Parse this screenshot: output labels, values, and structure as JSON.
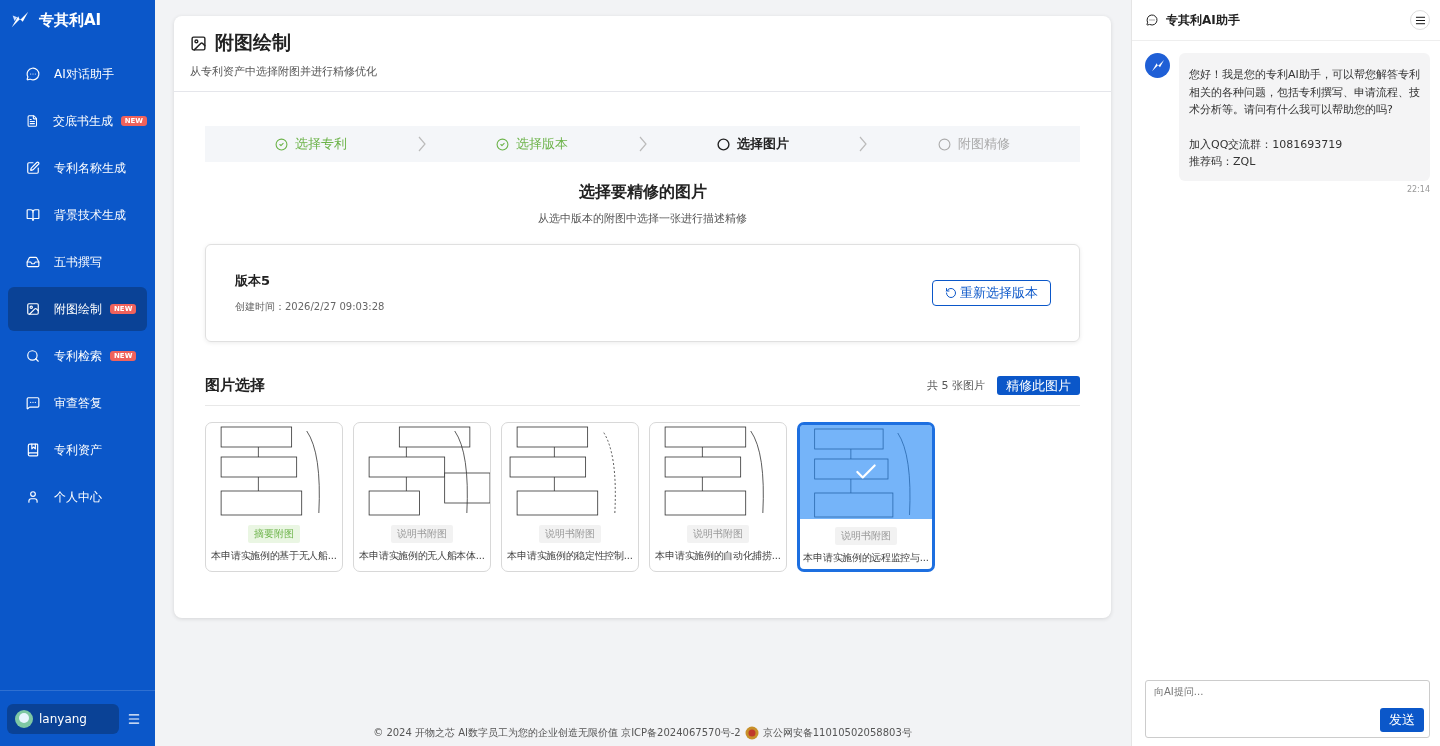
{
  "sidebar": {
    "brand": "专其利AI",
    "items": [
      {
        "label": "AI对话助手",
        "selected": false
      },
      {
        "label": "交底书生成",
        "badge": "NEW",
        "selected": false
      },
      {
        "label": "专利名称生成",
        "selected": false
      },
      {
        "label": "背景技术生成",
        "selected": false
      },
      {
        "label": "五书撰写",
        "selected": false
      },
      {
        "label": "附图绘制",
        "badge": "NEW",
        "selected": true
      },
      {
        "label": "专利检索",
        "badge": "NEW",
        "selected": false
      },
      {
        "label": "审查答复",
        "selected": false
      },
      {
        "label": "专利资产",
        "selected": false
      },
      {
        "label": "个人中心",
        "selected": false
      }
    ],
    "user": {
      "name": "lanyang"
    }
  },
  "page": {
    "title": "附图绘制",
    "subtitle": "从专利资产中选择附图并进行精修优化"
  },
  "steps": [
    {
      "label": "选择专利",
      "kind": "done"
    },
    {
      "label": "选择版本",
      "kind": "done"
    },
    {
      "label": "选择图片",
      "kind": "current"
    },
    {
      "label": "附图精修",
      "kind": "pending"
    }
  ],
  "section": {
    "title": "选择要精修的图片",
    "subtitle": "从选中版本的附图中选择一张进行描述精修"
  },
  "version": {
    "name": "版本5",
    "created": "创建时间：2026/2/27 09:03:28",
    "button": "重新选择版本"
  },
  "gallery": {
    "title": "图片选择",
    "count": "共 5 张图片",
    "button": "精修此图片",
    "images": [
      {
        "tag": "摘要附图",
        "kind": "abstract",
        "caption": "本申请实施例的基于无人船...",
        "selected": false
      },
      {
        "tag": "说明书附图",
        "kind": "spec",
        "caption": "本申请实施例的无人船本体...",
        "selected": false
      },
      {
        "tag": "说明书附图",
        "kind": "spec",
        "caption": "本申请实施例的稳定性控制...",
        "selected": false
      },
      {
        "tag": "说明书附图",
        "kind": "spec",
        "caption": "本申请实施例的自动化捕捞...",
        "selected": false
      },
      {
        "tag": "说明书附图",
        "kind": "spec",
        "caption": "本申请实施例的远程监控与...",
        "selected": true
      }
    ]
  },
  "chat": {
    "title": "专其利AI助手",
    "messages": [
      {
        "paragraphs": [
          "您好！我是您的专利AI助手，可以帮您解答专利相关的各种问题，包括专利撰写、申请流程、技术分析等。请问有什么我可以帮助您的吗?",
          "加入QQ交流群：1081693719\n推荐码：ZQL"
        ],
        "time": "22:14"
      }
    ],
    "input": {
      "placeholder": "向AI提问...",
      "button": "发送"
    }
  },
  "footer": {
    "copyright": "© 2024 开物之芯 AI数字员工为您的企业创造无限价值 京ICP备2024067570号-2",
    "police": "京公网安备11010502058803号"
  }
}
